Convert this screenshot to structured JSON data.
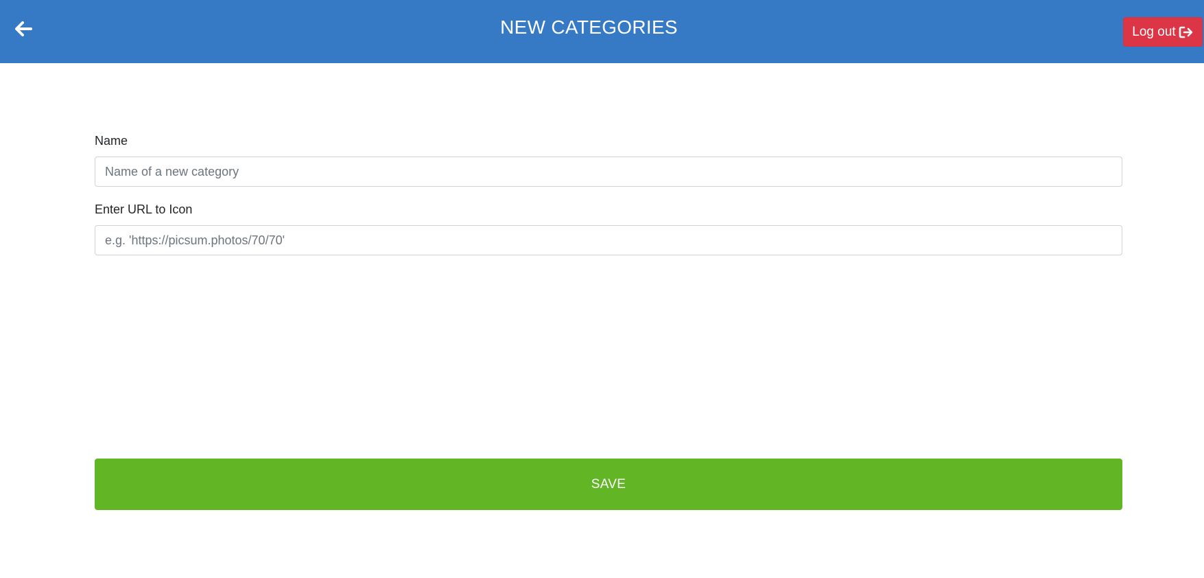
{
  "header": {
    "title": "NEW CATEGORIES",
    "back_icon": "arrow-left-icon",
    "logout_label": "Log out",
    "logout_icon": "sign-out-icon"
  },
  "form": {
    "name": {
      "label": "Name",
      "value": "",
      "placeholder": "Name of a new category"
    },
    "icon_url": {
      "label": "Enter URL to Icon",
      "value": "",
      "placeholder": "e.g. 'https://picsum.photos/70/70'"
    },
    "save_label": "SAVE"
  },
  "colors": {
    "header_bg": "#3679c4",
    "logout_bg": "#dc3545",
    "save_bg": "#62b625",
    "text_on_color": "#ffffff"
  }
}
